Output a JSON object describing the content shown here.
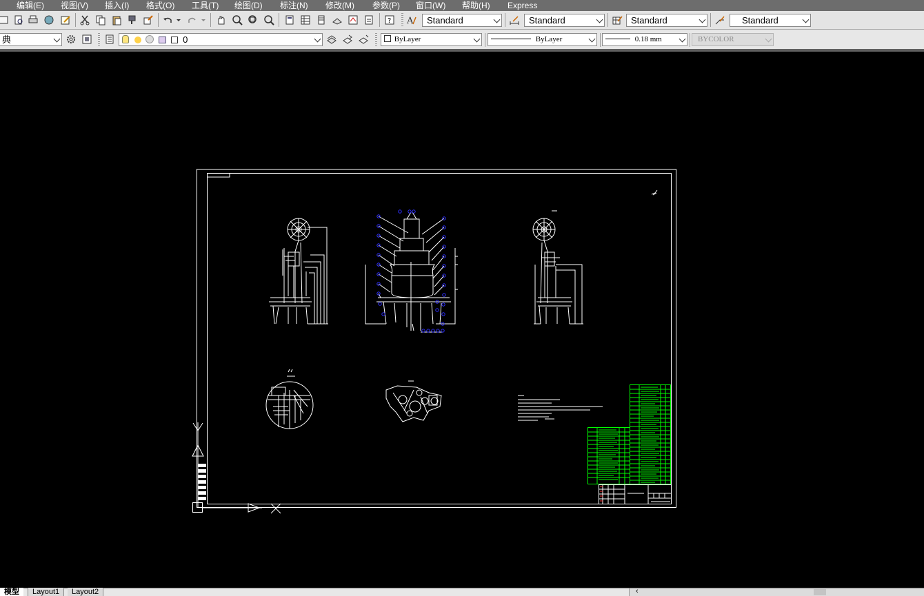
{
  "menu": [
    "编辑(E)",
    "视图(V)",
    "插入(I)",
    "格式(O)",
    "工具(T)",
    "绘图(D)",
    "标注(N)",
    "修改(M)",
    "参数(P)",
    "窗口(W)",
    "帮助(H)",
    "Express"
  ],
  "styles": {
    "text_style": "Standard",
    "dim_style": "Standard",
    "table_style": "Standard",
    "multileader_style": "Standard"
  },
  "workspace": {
    "value": "典"
  },
  "layer": {
    "current": "0"
  },
  "properties": {
    "color": "ByLayer",
    "linetype": "ByLayer",
    "lineweight": "0.18 mm",
    "plotstyle": "BYCOLOR"
  },
  "tabs": {
    "model": "模型",
    "layout1": "Layout1",
    "layout2": "Layout2"
  },
  "colors": {
    "background": "#000000",
    "drawing_line": "#ffffff",
    "bom_table": "#00ff00",
    "grip": "#3030ff",
    "menubar": "#6d6d6d",
    "toolbar": "#e4e4e4"
  }
}
